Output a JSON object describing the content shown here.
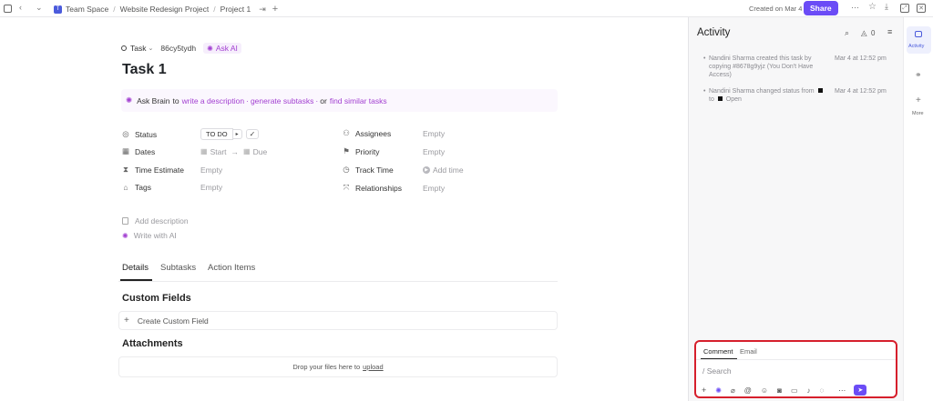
{
  "topbar": {
    "breadcrumbs": [
      "Team Space",
      "Website Redesign Project",
      "Project 1"
    ],
    "created_text": "Created on Mar 4",
    "share_label": "Share"
  },
  "task": {
    "type_label": "Task",
    "id": "86cy5tydh",
    "ask_ai_label": "Ask AI",
    "title": "Task 1",
    "ask_brain": {
      "prefix": "Ask Brain",
      "to": "to",
      "write": "write a description",
      "dot1": "·",
      "generate": "generate subtasks",
      "dot2": "·",
      "or": "or",
      "find": "find similar tasks"
    },
    "fields": {
      "status_label": "Status",
      "status_value": "TO DO",
      "dates_label": "Dates",
      "start": "Start",
      "arrow": "→",
      "due": "Due",
      "time_estimate_label": "Time Estimate",
      "time_estimate_value": "Empty",
      "tags_label": "Tags",
      "tags_value": "Empty",
      "assignees_label": "Assignees",
      "assignees_value": "Empty",
      "priority_label": "Priority",
      "priority_value": "Empty",
      "track_time_label": "Track Time",
      "track_time_value": "Add time",
      "relationships_label": "Relationships",
      "relationships_value": "Empty"
    },
    "add_description": "Add description",
    "write_with_ai": "Write with AI",
    "tabs": [
      "Details",
      "Subtasks",
      "Action Items"
    ],
    "custom_fields_title": "Custom Fields",
    "create_custom_field": "Create Custom Field",
    "attachments_title": "Attachments",
    "drop_text": "Drop your files here to",
    "upload_link": "upload"
  },
  "activity": {
    "title": "Activity",
    "notification_count": "0",
    "entries": [
      {
        "text": "Nandini Sharma created this task by copying #8678g9yjz (You Don't Have Access)",
        "time": "Mar 4 at 12:52 pm"
      },
      {
        "text_a": "Nandini Sharma changed status from",
        "text_b": "to",
        "text_c": "Open",
        "time": "Mar 4 at 12:52 pm"
      }
    ],
    "composer": {
      "tabs": [
        "Comment",
        "Email"
      ],
      "placeholder": "/ Search"
    }
  },
  "rail": {
    "activity_label": "Activity",
    "more_label": "More"
  },
  "colors": {
    "accent": "#6b4cf6",
    "ai_purple": "#a23fd1",
    "highlight_red": "#d61f2c"
  }
}
